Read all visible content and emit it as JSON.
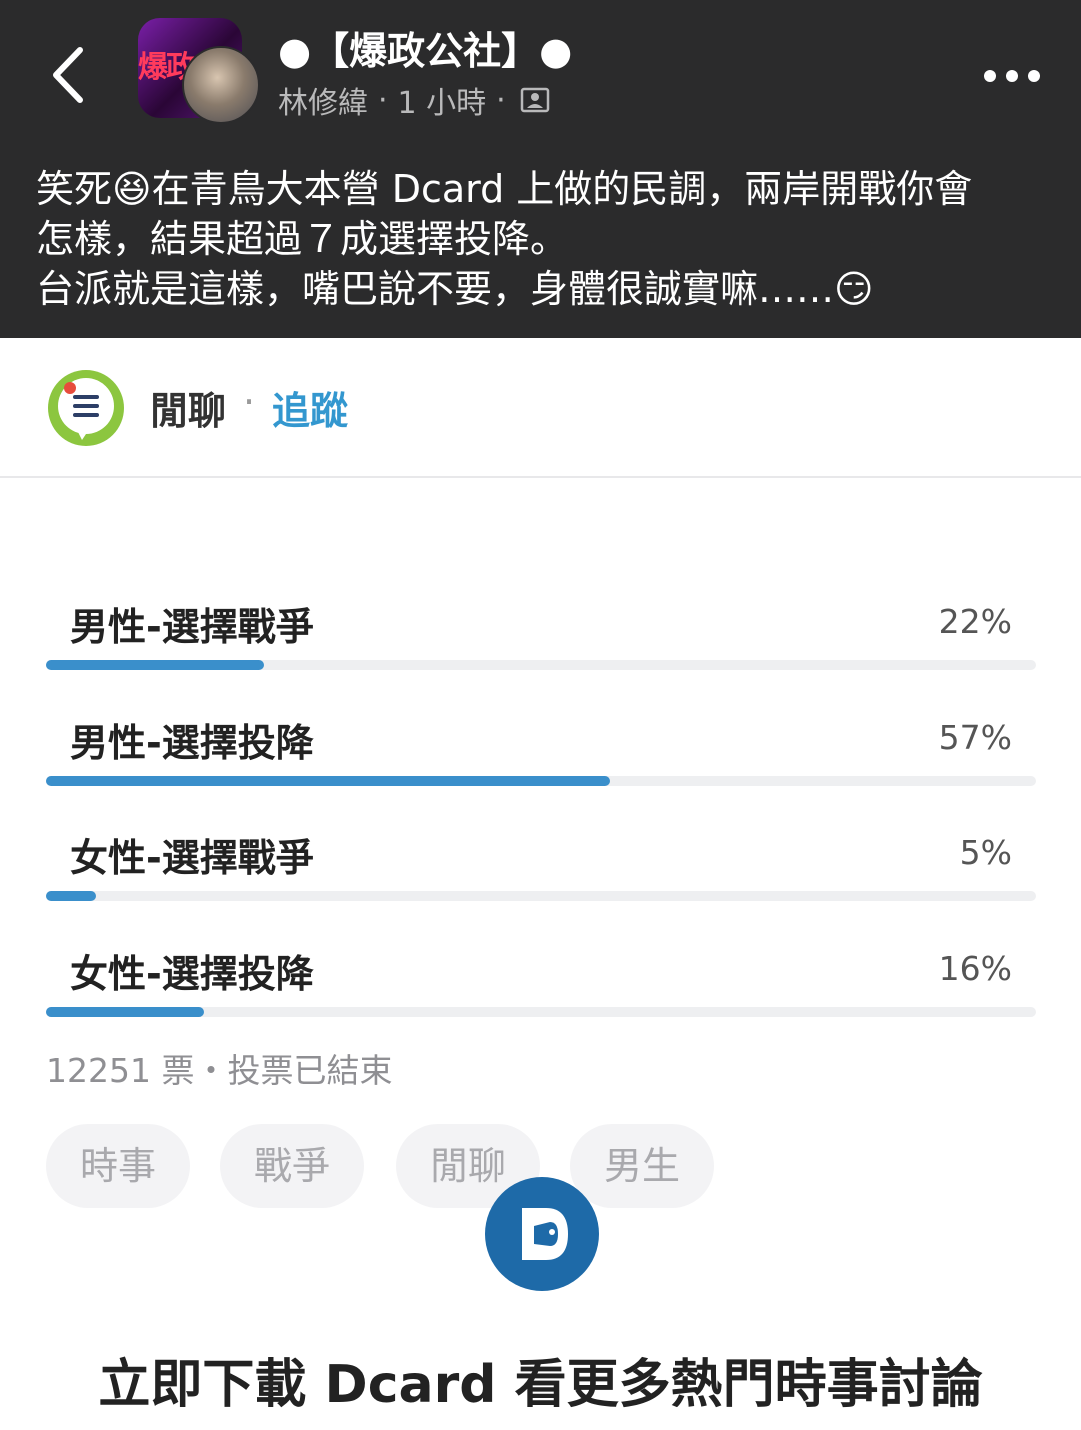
{
  "post": {
    "page_name": "●【爆政公社】●",
    "avatar_text": "爆政",
    "author": "林修緯",
    "separator": "·",
    "time": "1 小時",
    "text_lines": [
      "笑死😆在青鳥大本營 Dcard 上做的民調，兩岸開戰你會",
      "怎樣，結果超過７成選擇投降。",
      "台派就是這樣，嘴巴說不要，身體很誠實嘛……😏"
    ]
  },
  "board": {
    "name": "閒聊",
    "dot": "·",
    "follow_label": "追蹤"
  },
  "poll": {
    "options": [
      {
        "label": "男性-選擇戰爭",
        "percent_text": "22%",
        "share": 0.22
      },
      {
        "label": "男性-選擇投降",
        "percent_text": "57%",
        "share": 0.57
      },
      {
        "label": "女性-選擇戰爭",
        "percent_text": "5%",
        "share": 0.05
      },
      {
        "label": "女性-選擇投降",
        "percent_text": "16%",
        "share": 0.16
      }
    ],
    "footer": "12251 票・投票已結束"
  },
  "tags": [
    "時事",
    "戰爭",
    "閒聊",
    "男生"
  ],
  "cta": "立即下載 Dcard 看更多熱門時事討論",
  "colors": {
    "accent": "#3a8fcb",
    "link": "#3397cf",
    "header_bg": "#2b2b2c",
    "bar_track": "#eeeff1"
  },
  "icons": [
    "back-chevron-icon",
    "photo-icon",
    "more-dots-icon",
    "board-chat-icon",
    "dcard-logo-icon"
  ]
}
